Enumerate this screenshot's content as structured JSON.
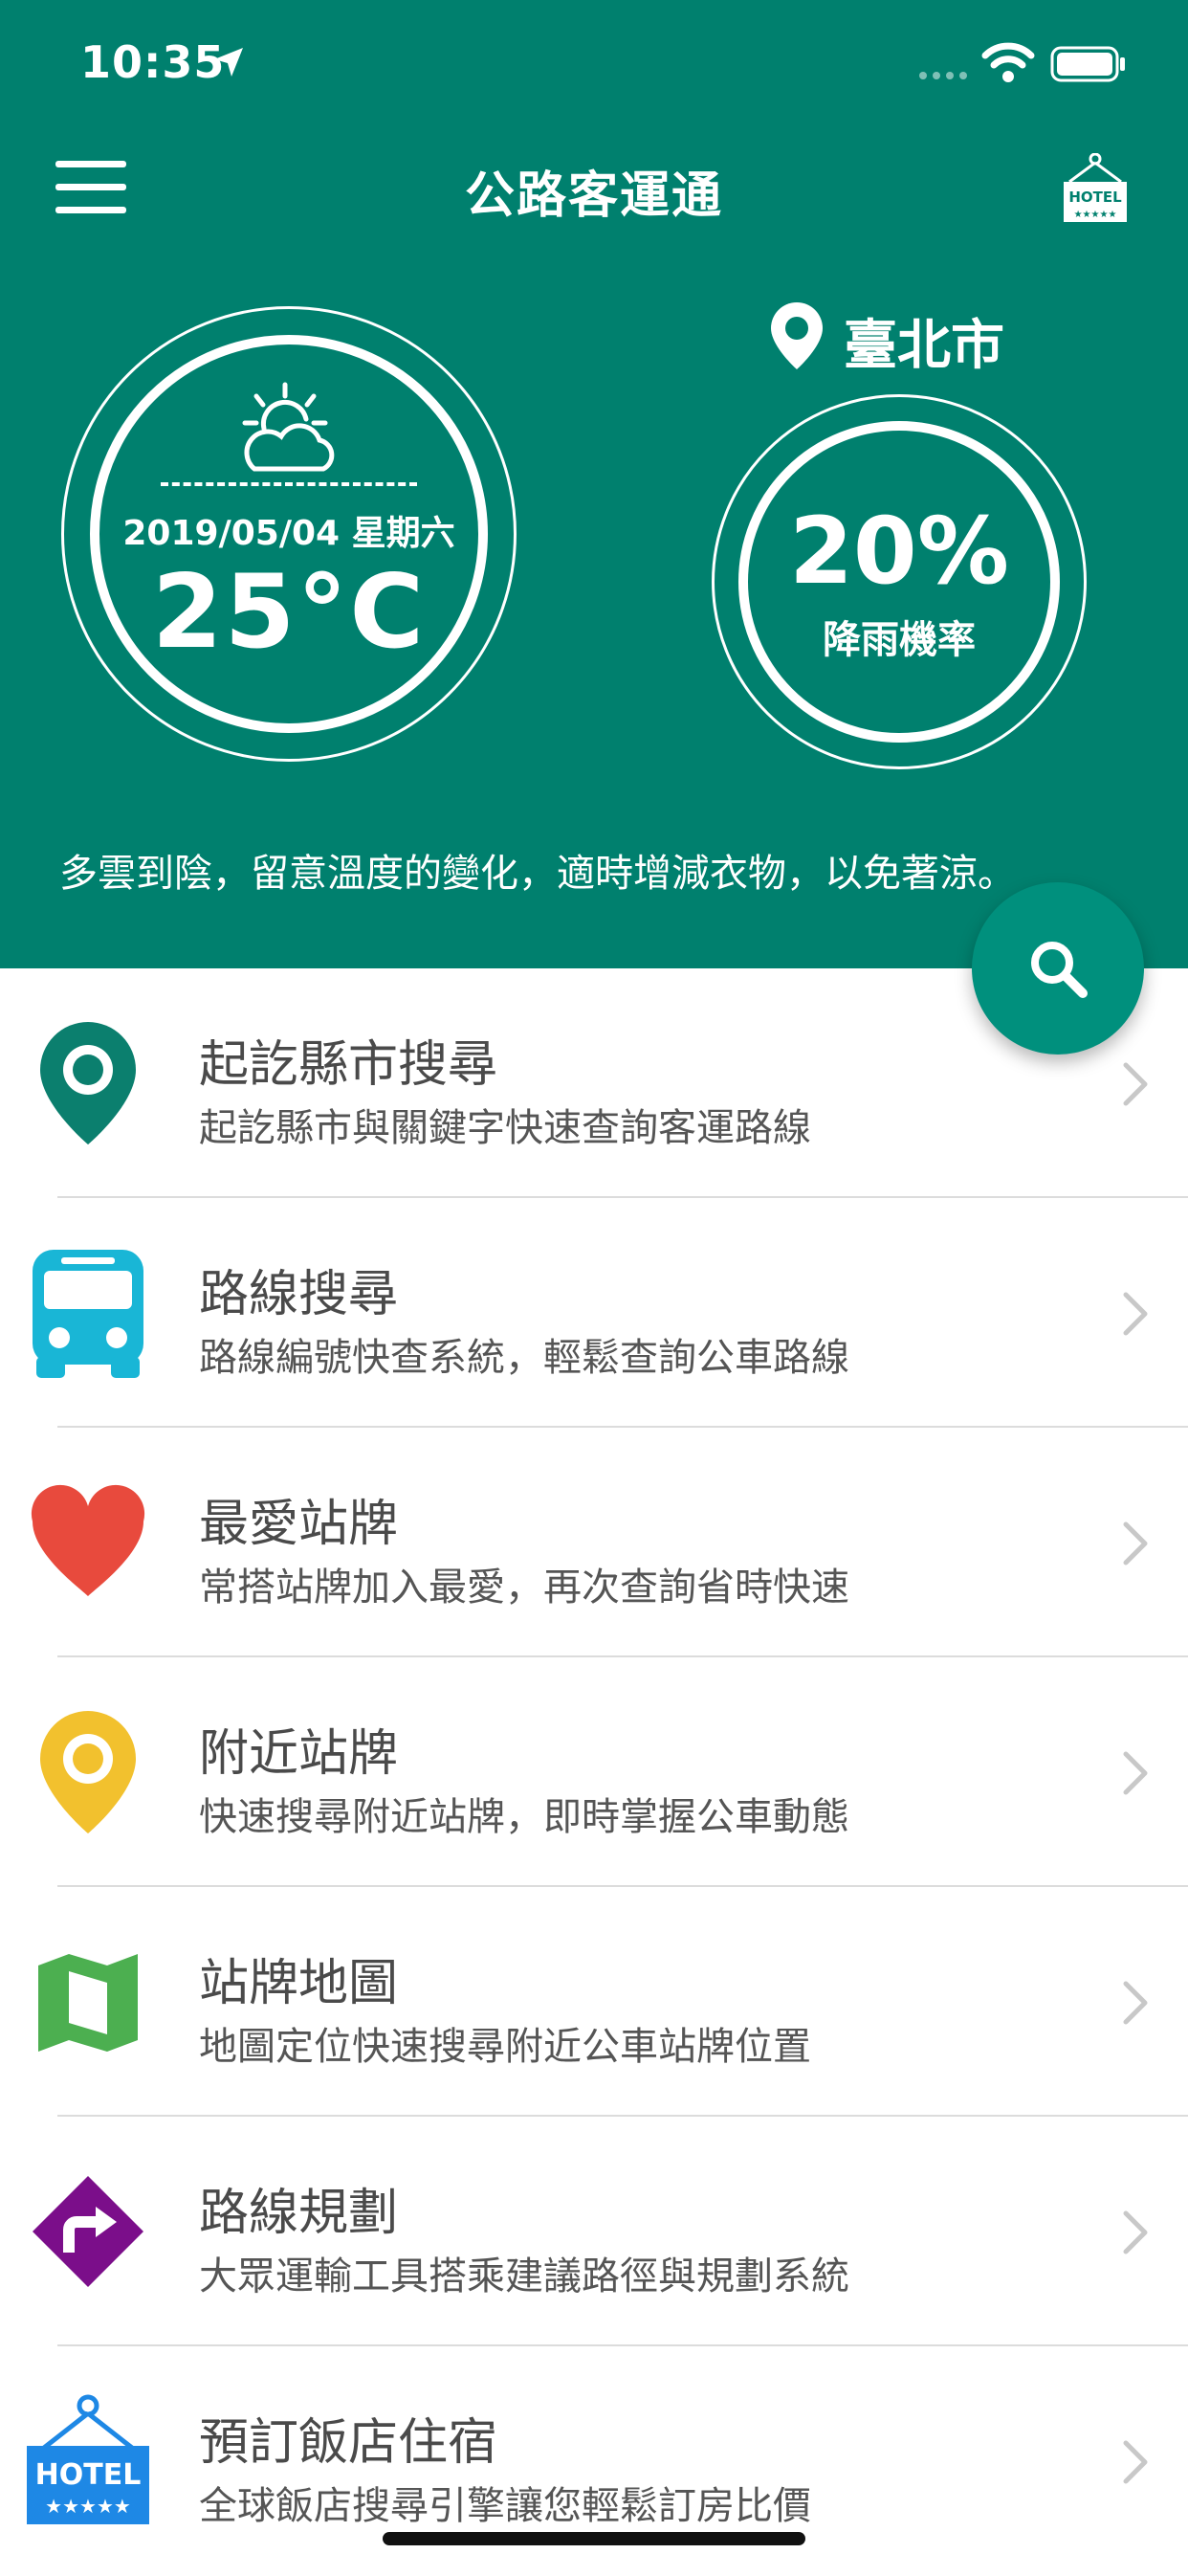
{
  "status_bar": {
    "time": "10:35"
  },
  "header": {
    "title": "公路客運通",
    "hotel_sign": "HOTEL",
    "hotel_stars": "★★★★★",
    "bg_color": "#00806e"
  },
  "weather": {
    "icon": "partly-cloudy-sun-icon",
    "date": "2019/05/04 星期六",
    "temperature": "25°C",
    "city": "臺北市",
    "rain_probability": "20%",
    "rain_label": "降雨機率",
    "tip": "多雲到陰，留意溫度的變化，適時增減衣物，以免著涼。"
  },
  "menu": {
    "items": [
      {
        "title": "起訖縣市搜尋",
        "desc": "起訖縣市與關鍵字快速查詢客運路線",
        "icon": "location-pin-icon",
        "color": "#0b7f6e"
      },
      {
        "title": "路線搜尋",
        "desc": "路線編號快查系統，輕鬆查詢公車路線",
        "icon": "bus-icon",
        "color": "#19b6d6"
      },
      {
        "title": "最愛站牌",
        "desc": "常搭站牌加入最愛，再次查詢省時快速",
        "icon": "heart-icon",
        "color": "#e84a3d"
      },
      {
        "title": "附近站牌",
        "desc": "快速搜尋附近站牌，即時掌握公車動態",
        "icon": "location-pin-icon",
        "color": "#f2c12e"
      },
      {
        "title": "站牌地圖",
        "desc": "地圖定位快速搜尋附近公車站牌位置",
        "icon": "map-icon",
        "color": "#4caf50"
      },
      {
        "title": "路線規劃",
        "desc": "大眾運輸工具搭乘建議路徑與規劃系統",
        "icon": "route-sign-icon",
        "color": "#7b0e8a"
      },
      {
        "title": "預訂飯店住宿",
        "desc": "全球飯店搜尋引擎讓您輕鬆訂房比價",
        "icon": "hotel-sign-icon",
        "color": "#1e88e5",
        "sign": "HOTEL",
        "stars": "★★★★★"
      }
    ]
  }
}
